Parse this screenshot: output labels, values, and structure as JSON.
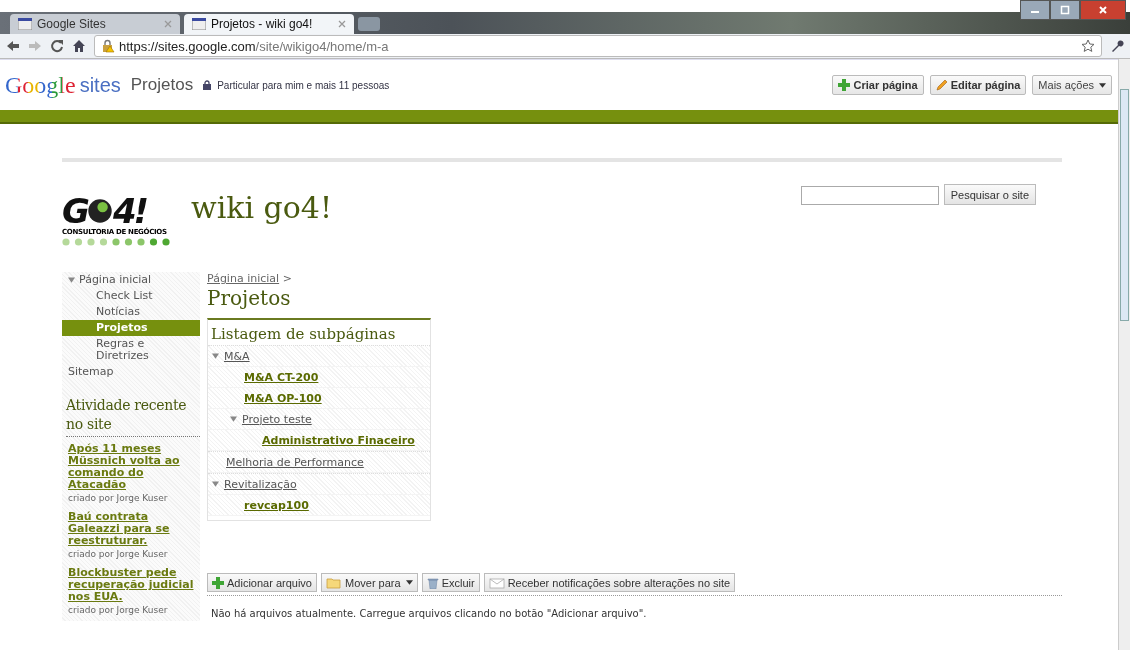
{
  "browser": {
    "tabs": [
      {
        "title": "Google Sites",
        "selected": false
      },
      {
        "title": "Projetos - wiki go4!",
        "selected": true
      }
    ],
    "url": {
      "host": "https://sites.google.com",
      "path": "/site/wikigo4/home/m-a"
    }
  },
  "sites_bar": {
    "brand_google": "Google",
    "brand_sites": "sites",
    "page_title": "Projetos",
    "sharing": "Particular para mim e mais 11 pessoas",
    "buttons": [
      {
        "label": "Criar página",
        "kind": "create"
      },
      {
        "label": "Editar página",
        "kind": "edit"
      },
      {
        "label": "Mais ações",
        "kind": "menu"
      }
    ]
  },
  "header": {
    "logo": {
      "parts": [
        "G",
        "4!"
      ],
      "tagline": "CONSULTORIA DE NEGÓCIOS"
    },
    "site_title": "wiki go4!",
    "search_button": "Pesquisar o site"
  },
  "sidebar": {
    "nav": [
      {
        "label": "Página inicial",
        "expanded": true,
        "selected": false,
        "children": [
          {
            "label": "Check List",
            "selected": false
          },
          {
            "label": "Notícias",
            "selected": false
          },
          {
            "label": "Projetos",
            "selected": true
          },
          {
            "label": "Regras e Diretrizes",
            "selected": false
          }
        ]
      },
      {
        "label": "Sitemap",
        "selected": false
      }
    ],
    "recent_title": "Atividade recente no site",
    "recent": [
      {
        "title": "Após 11 meses Müssnich volta ao comando do Atacadão",
        "byline": "criado por Jorge Kuser"
      },
      {
        "title": "Baú contrata Galeazzi para se reestruturar.",
        "byline": "criado por Jorge Kuser"
      },
      {
        "title": "Blockbuster pede recuperação judicial nos EUA.",
        "byline": "criado por Jorge Kuser"
      }
    ]
  },
  "main": {
    "breadcrumb": {
      "link": "Página inicial",
      "separator": ">"
    },
    "title": "Projetos",
    "subpages": {
      "title": "Listagem de subpáginas",
      "items": [
        {
          "label": "M&A",
          "expanded": true,
          "children": [
            {
              "label": "M&A CT-200"
            },
            {
              "label": "M&A OP-100"
            },
            {
              "label": "Projeto teste",
              "expanded": true,
              "children": [
                {
                  "label": "Administrativo Finaceiro"
                }
              ]
            }
          ]
        },
        {
          "label": "Melhoria de Performance"
        },
        {
          "label": "Revitalização",
          "expanded": true,
          "children": [
            {
              "label": "revcap100"
            }
          ]
        }
      ]
    },
    "file_buttons": [
      {
        "label": "Adicionar arquivo",
        "kind": "add"
      },
      {
        "label": "Mover para",
        "kind": "move"
      },
      {
        "label": "Excluir",
        "kind": "delete"
      },
      {
        "label": "Receber notificações sobre alterações no site",
        "kind": "notify"
      }
    ],
    "empty_message": "Não há arquivos atualmente. Carregue arquivos clicando no botão \"Adicionar arquivo\"."
  }
}
